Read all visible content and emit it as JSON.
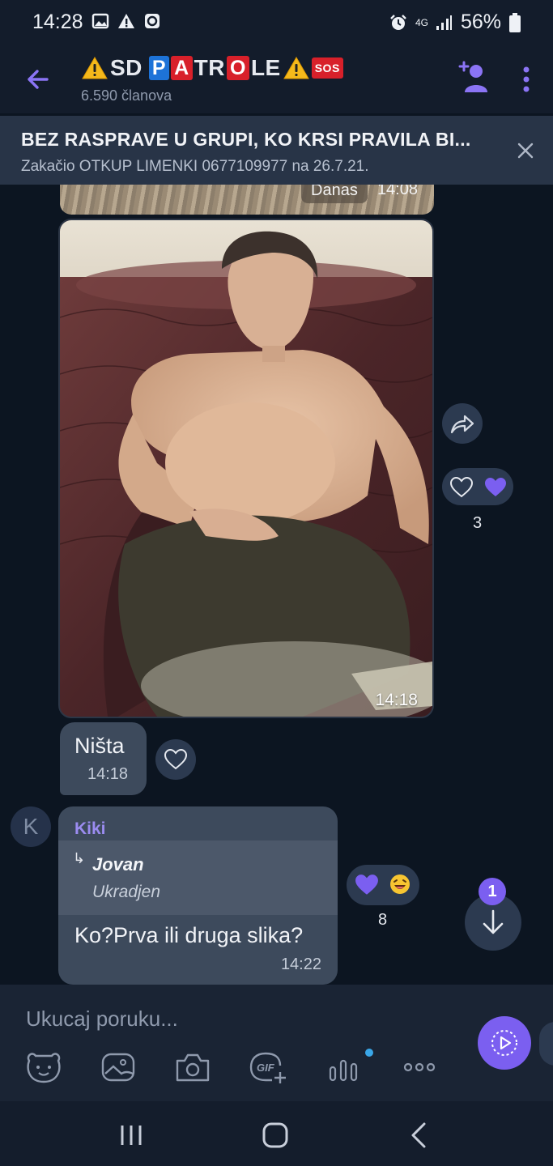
{
  "status": {
    "time": "14:28",
    "network": "4G",
    "battery": "56%"
  },
  "header": {
    "title_parts": [
      "SD",
      "P",
      "A",
      "TR",
      "O",
      "LE",
      "SOS"
    ],
    "member_count": "6.590 članova"
  },
  "pinned": {
    "title": "BEZ RASPRAVE U GRUPI, KO KRSI PRAVILA BI...",
    "subtitle": "Zakačio OTKUP LIMENKI 0677109977 na 26.7.21."
  },
  "messages": {
    "previous_photo": {
      "label": "Danas",
      "time": "14:08"
    },
    "photo": {
      "time": "14:18",
      "reaction_count": "3"
    },
    "nista": {
      "text": "Ništa",
      "time": "14:18"
    },
    "kiki": {
      "avatar_letter": "K",
      "sender": "Kiki",
      "reply_author": "Jovan",
      "reply_text": "Ukradjen",
      "text": "Ko?Prva ili druga slika?",
      "time": "14:22",
      "reaction_count": "8"
    }
  },
  "unread_count": "1",
  "composer": {
    "placeholder": "Ukucaj poruku..."
  },
  "tools": [
    "sticker-icon",
    "gallery-icon",
    "camera-icon",
    "gif-icon",
    "poll-icon",
    "more-icon"
  ],
  "colors": {
    "background": "#0c1521",
    "header": "#131c2b",
    "bubble": "#3d4a5c",
    "accent": "#7b5ff0",
    "sender_name": "#9b8cf0"
  }
}
